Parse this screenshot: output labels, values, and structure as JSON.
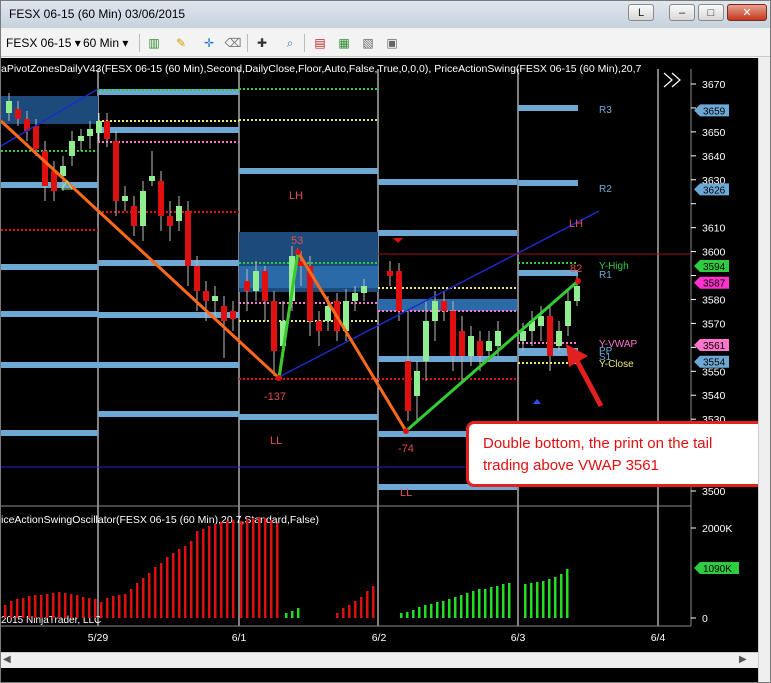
{
  "window": {
    "title": "FESX 06-15 (60 Min)  03/06/2015",
    "buttons": {
      "lock": "L",
      "minimize": "–",
      "maximize": "□",
      "close": "✕"
    }
  },
  "toolbar": {
    "instrument": "FESX 06-15",
    "interval": "60 Min",
    "icons": [
      "bar-style-icon",
      "pencil-icon",
      "crosshair-tool-icon",
      "eraser-icon",
      "cursor-crosshair-icon",
      "zoom-icon",
      "indicators-icon",
      "strategies-icon",
      "chart-properties-icon",
      "data-box-icon"
    ]
  },
  "chart": {
    "indicator_header": "aPivotZonesDailyV43(FESX 06-15 (60 Min),Second,DailyClose,Floor,Auto,False,True,0,0,0), PriceActionSwing(FESX 06-15 (60 Min),20,7",
    "oscillator_header": "iceActionSwingOscillator(FESX 06-15 (60 Min),20,7,Standard,False)",
    "copyright": "2015 NinjaTrader, LLC",
    "colors": {
      "background": "#000000",
      "up_candle": "#90ee90",
      "down_candle": "#e01010",
      "zone": "#6ea9d6",
      "swing_up": "#33cc33",
      "swing_down": "#ff6a1a",
      "trend_line": "#1a2cc8"
    },
    "price_axis": {
      "ticks": [
        3670,
        3660,
        3650,
        3640,
        3630,
        3620,
        3610,
        3600,
        3590,
        3580,
        3570,
        3560,
        3550,
        3540,
        3530,
        3520,
        3510,
        3500
      ],
      "labels": [
        "3670",
        "3650",
        "3640",
        "3630",
        "3610",
        "3600",
        "3580",
        "3570",
        "3550",
        "3540",
        "3530",
        "3520",
        "3510",
        "3500"
      ],
      "markers": [
        {
          "value": "3659",
          "color": "#6ea9d6"
        },
        {
          "value": "3626",
          "color": "#6ea9d6"
        },
        {
          "value": "3594",
          "color": "#2ecc40"
        },
        {
          "value": "3587",
          "color": "#ff33cc"
        },
        {
          "value": "3561",
          "color": "#ff77cc"
        },
        {
          "value": "3554",
          "color": "#6ea9d6"
        }
      ]
    },
    "osc_axis": {
      "labels": [
        "2000K",
        "1090K",
        "0"
      ],
      "marker": "1090K"
    },
    "date_axis": [
      "5/29",
      "6/1",
      "6/2",
      "6/3",
      "6/4"
    ],
    "pivot_labels": [
      "R3",
      "R2",
      "R1",
      "Y-High",
      "Y-VWAP",
      "PP",
      "S1",
      "Y-Close"
    ],
    "swing_labels": {
      "lh1": "LH",
      "v53": "53",
      "ll1": "LL",
      "v137": "-137",
      "lh2": "LH",
      "v74": "-74",
      "ll2": "LL",
      "v82": "82"
    }
  },
  "callout": {
    "text": "Double bottom, the print on the tail trading above VWAP 3561"
  }
}
